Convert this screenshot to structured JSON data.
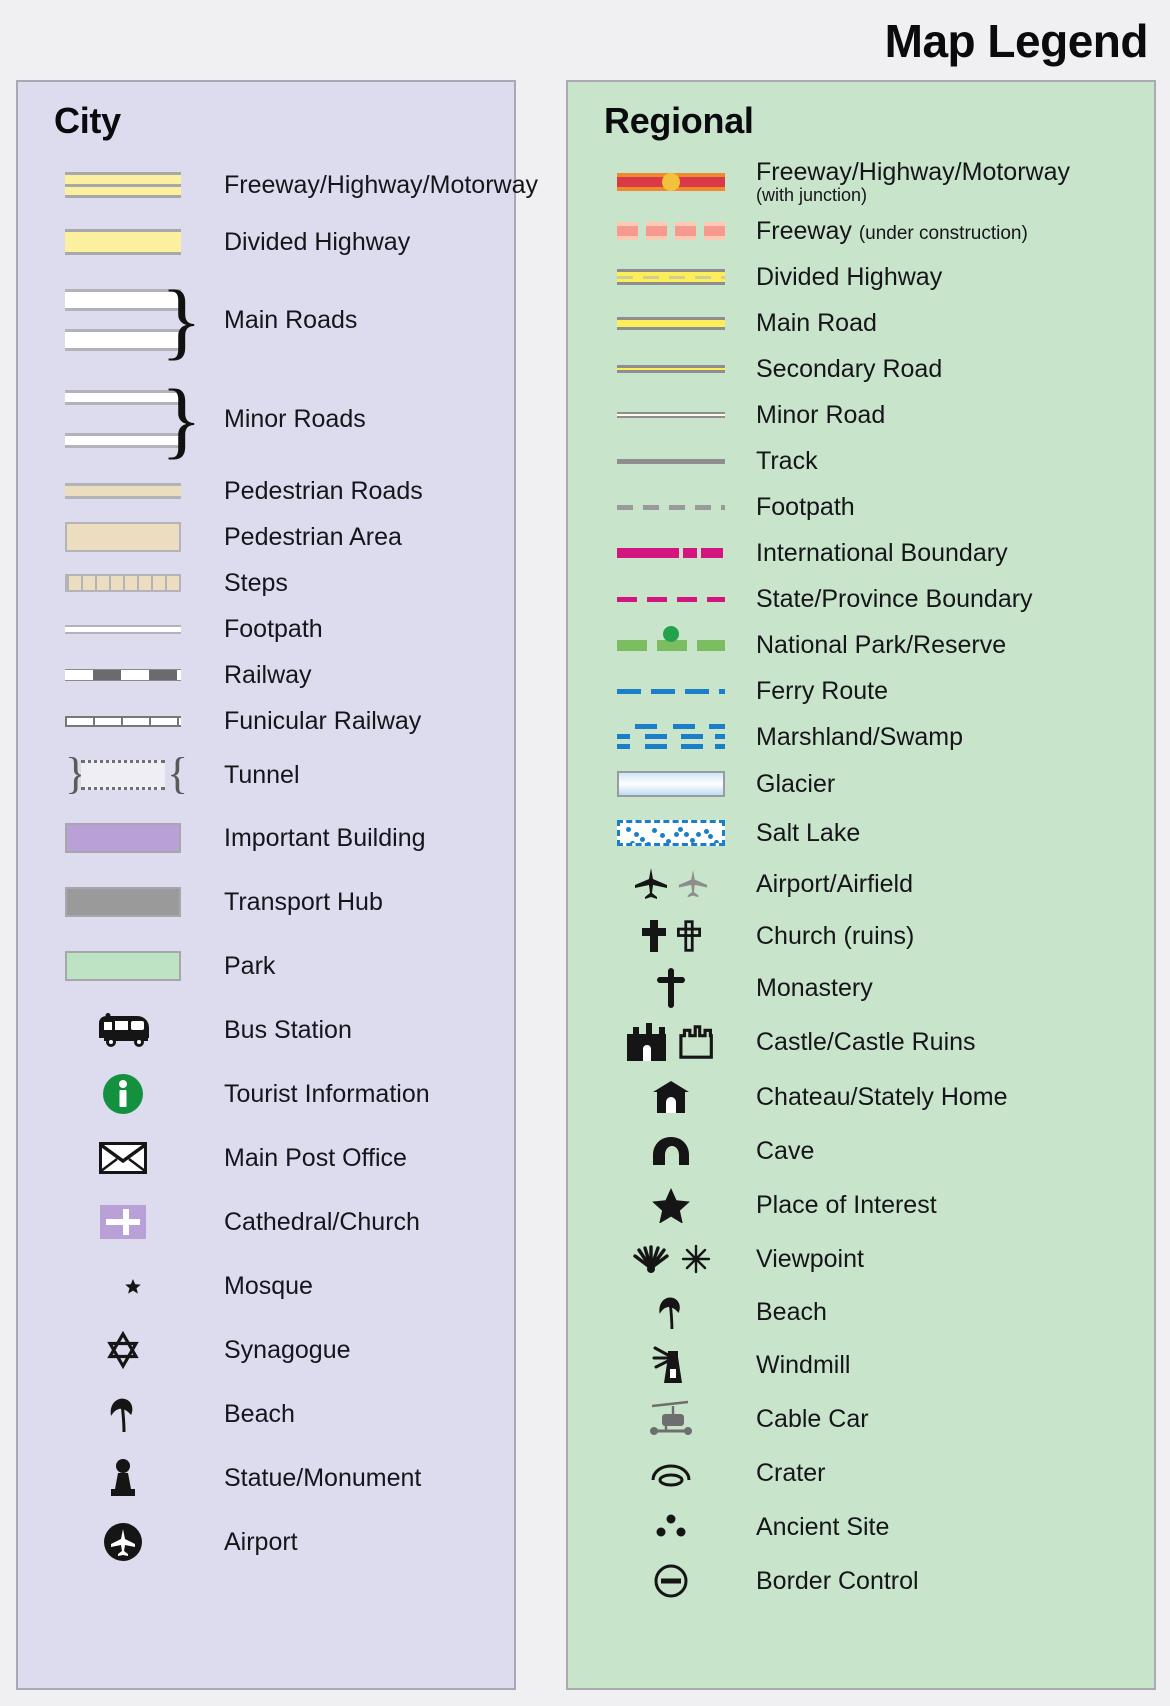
{
  "title": "Map Legend",
  "city": {
    "heading": "City",
    "items": [
      {
        "label": "Freeway/Highway/Motorway",
        "symbol": "freeway-city"
      },
      {
        "label": "Divided Highway",
        "symbol": "divided-highway-city"
      },
      {
        "label": "Main Roads",
        "symbol": "main-roads-city"
      },
      {
        "label": "Minor Roads",
        "symbol": "minor-roads-city"
      },
      {
        "label": "Pedestrian Roads",
        "symbol": "pedestrian-road-city"
      },
      {
        "label": "Pedestrian Area",
        "symbol": "pedestrian-area-city"
      },
      {
        "label": "Steps",
        "symbol": "steps-city"
      },
      {
        "label": "Footpath",
        "symbol": "footpath-city"
      },
      {
        "label": "Railway",
        "symbol": "railway-city"
      },
      {
        "label": "Funicular Railway",
        "symbol": "funicular-city"
      },
      {
        "label": "Tunnel",
        "symbol": "tunnel-city"
      },
      {
        "label": "Important Building",
        "symbol": "important-building-swatch"
      },
      {
        "label": "Transport Hub",
        "symbol": "transport-hub-swatch"
      },
      {
        "label": "Park",
        "symbol": "park-swatch"
      },
      {
        "label": "Bus Station",
        "symbol": "bus-icon"
      },
      {
        "label": "Tourist Information",
        "symbol": "information-icon"
      },
      {
        "label": "Main Post Office",
        "symbol": "envelope-icon"
      },
      {
        "label": "Cathedral/Church",
        "symbol": "cathedral-cross-icon"
      },
      {
        "label": "Mosque",
        "symbol": "crescent-star-icon"
      },
      {
        "label": "Synagogue",
        "symbol": "star-of-david-icon"
      },
      {
        "label": "Beach",
        "symbol": "beach-umbrella-icon"
      },
      {
        "label": "Statue/Monument",
        "symbol": "statue-icon"
      },
      {
        "label": "Airport",
        "symbol": "airport-circle-icon"
      }
    ]
  },
  "regional": {
    "heading": "Regional",
    "items": [
      {
        "label": "Freeway/Highway/Motorway",
        "sub2": "(with junction)",
        "symbol": "freeway-junction"
      },
      {
        "label": "Freeway",
        "sub": "(under construction)",
        "symbol": "freeway-under-construction"
      },
      {
        "label": "Divided Highway",
        "symbol": "divided-highway-regional"
      },
      {
        "label": "Main Road",
        "symbol": "main-road-regional"
      },
      {
        "label": "Secondary Road",
        "symbol": "secondary-road-regional"
      },
      {
        "label": "Minor Road",
        "symbol": "minor-road-regional"
      },
      {
        "label": "Track",
        "symbol": "track-regional"
      },
      {
        "label": "Footpath",
        "symbol": "footpath-regional"
      },
      {
        "label": "International Boundary",
        "symbol": "international-boundary"
      },
      {
        "label": "State/Province Boundary",
        "symbol": "state-boundary"
      },
      {
        "label": "National Park/Reserve",
        "symbol": "national-park"
      },
      {
        "label": "Ferry Route",
        "symbol": "ferry-route"
      },
      {
        "label": "Marshland/Swamp",
        "symbol": "marshland"
      },
      {
        "label": "Glacier",
        "symbol": "glacier-swatch"
      },
      {
        "label": "Salt Lake",
        "symbol": "salt-lake-swatch"
      },
      {
        "label": "Airport/Airfield",
        "symbol": "airplane-icon"
      },
      {
        "label": "Church (ruins)",
        "symbol": "church-cross-icon"
      },
      {
        "label": "Monastery",
        "symbol": "monastery-cross-icon"
      },
      {
        "label": "Castle/Castle Ruins",
        "symbol": "castle-icon"
      },
      {
        "label": "Chateau/Stately Home",
        "symbol": "chateau-icon"
      },
      {
        "label": "Cave",
        "symbol": "cave-icon"
      },
      {
        "label": "Place of Interest",
        "symbol": "star-icon"
      },
      {
        "label": "Viewpoint",
        "symbol": "viewpoint-icon"
      },
      {
        "label": "Beach",
        "symbol": "beach-umbrella-icon"
      },
      {
        "label": "Windmill",
        "symbol": "windmill-icon"
      },
      {
        "label": "Cable Car",
        "symbol": "cable-car-icon"
      },
      {
        "label": "Crater",
        "symbol": "crater-icon"
      },
      {
        "label": "Ancient Site",
        "symbol": "ancient-site-icon"
      },
      {
        "label": "Border Control",
        "symbol": "border-control-icon"
      }
    ]
  },
  "colors": {
    "city_panel": "#dcdcee",
    "regional_panel": "#c8e4cb",
    "page_background": "#f0f0f2",
    "highway_yellow": "#faf0a0",
    "regional_yellow": "#fcee5a",
    "freeway_red": "#d83a47",
    "freeway_orange": "#f08a2e",
    "junction_dot": "#f2c23c",
    "boundary_magenta": "#d4157f",
    "park_green": "#7dbd62",
    "water_blue": "#1a7ec8",
    "important_building": "#b9a0d6",
    "transport_hub": "#9a9a9a",
    "park_swatch": "#bde3c4",
    "pedestrian_tan": "#ecdcc0",
    "info_green": "#14913f"
  }
}
